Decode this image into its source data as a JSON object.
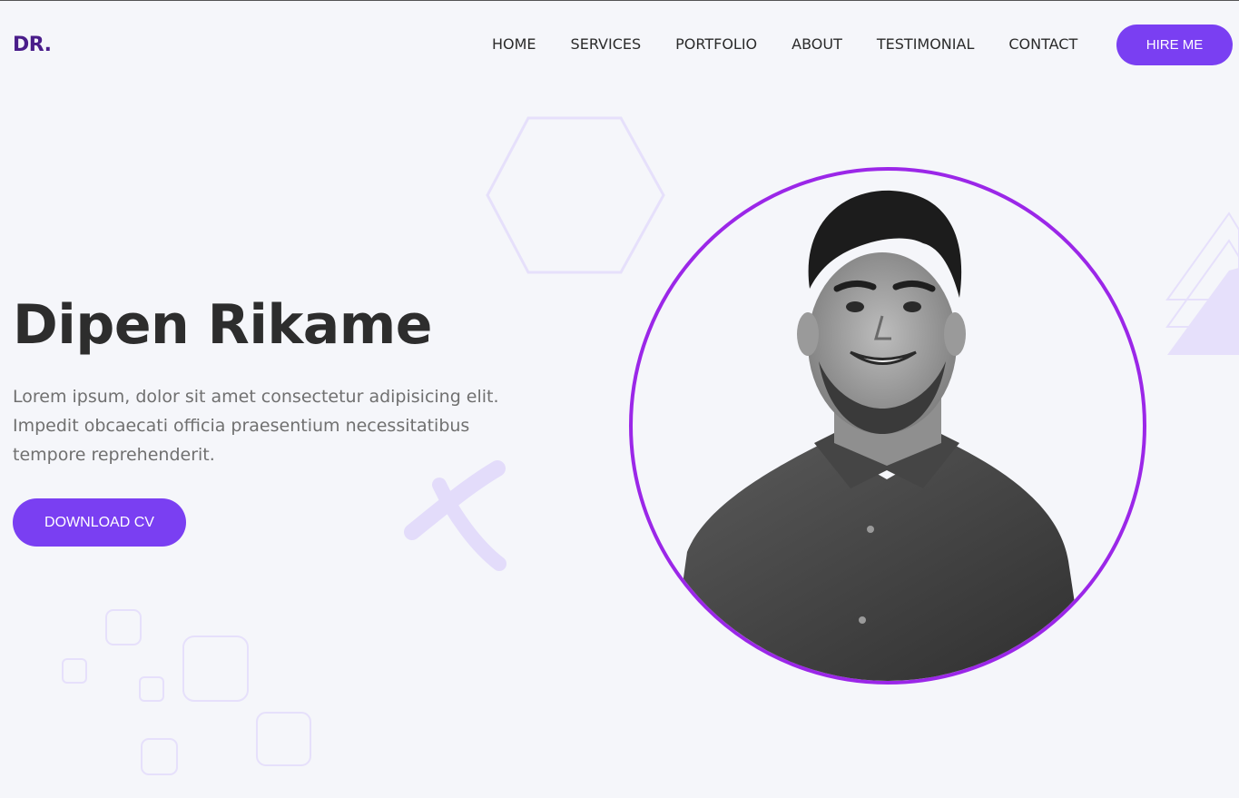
{
  "header": {
    "logo": "DR.",
    "nav": [
      {
        "label": "HOME"
      },
      {
        "label": "SERVICES"
      },
      {
        "label": "PORTFOLIO"
      },
      {
        "label": "ABOUT"
      },
      {
        "label": "TESTIMONIAL"
      },
      {
        "label": "CONTACT"
      }
    ],
    "hire_label": "HIRE ME"
  },
  "hero": {
    "name": "Dipen Rikame",
    "description": "Lorem ipsum, dolor sit amet consectetur adipisicing elit. Impedit obcaecati officia praesentium necessitatibus tempore reprehenderit.",
    "cv_label": "DOWNLOAD CV"
  },
  "colors": {
    "accent": "#7a3ff2",
    "logo": "#4a1d8a",
    "portrait_ring": "#9b27e8",
    "background": "#f5f6fa",
    "decoration": "#e6e0fb"
  },
  "icons": {
    "hexagon": "hexagon-shape",
    "cross": "x-shape",
    "triangles": "triangle-shape",
    "squares": "rounded-square-shape"
  }
}
